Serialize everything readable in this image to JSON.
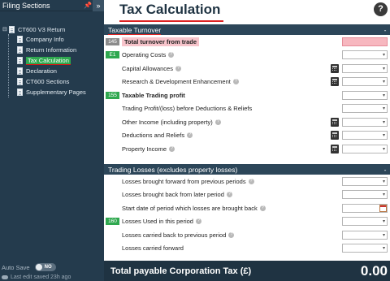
{
  "sidebar": {
    "title": "Filing Sections",
    "pin_icon": "pin-icon",
    "collapse_icon": "double-chevron-right-icon",
    "root": {
      "toggle": "⊟",
      "label": "CT600 V3 Return"
    },
    "items": [
      {
        "label": "Company Info",
        "active": false
      },
      {
        "label": "Return Information",
        "active": false
      },
      {
        "label": "Tax Calculation",
        "active": true
      },
      {
        "label": "Declaration",
        "active": false
      },
      {
        "label": "CT600 Sections",
        "active": false
      },
      {
        "label": "Supplementary Pages",
        "active": false
      }
    ],
    "autosave_label": "Auto Save",
    "autosave_toggle": "NO",
    "last_edit": "Last edit saved 23h ago"
  },
  "main": {
    "title": "Tax Calculation",
    "help_icon": "question-mark-icon",
    "section1": {
      "header": "Taxable Turnover",
      "rows": [
        {
          "box": "145",
          "label": "Total turnover from trade"
        },
        {
          "box": "E1",
          "label": "Operating Costs"
        },
        {
          "box": "",
          "label": "Capital Allowances"
        },
        {
          "box": "",
          "label": "Research & Development Enhancement"
        },
        {
          "box": "155",
          "label": "Taxable Trading profit"
        },
        {
          "box": "",
          "label": "Trading Profit/(loss) before Deductions & Reliefs"
        },
        {
          "box": "",
          "label": "Other Income (including property)"
        },
        {
          "box": "",
          "label": "Deductions and Reliefs"
        },
        {
          "box": "",
          "label": "Property Income"
        }
      ]
    },
    "section2": {
      "header": "Trading Losses (excludes property losses)",
      "rows": [
        {
          "box": "",
          "label": "Losses brought forward from previous periods"
        },
        {
          "box": "",
          "label": "Losses brought back from later period"
        },
        {
          "box": "",
          "label": "Start date of period which losses are brought back"
        },
        {
          "box": "160",
          "label": "Losses Used in this period"
        },
        {
          "box": "",
          "label": "Losses carried back to previous period"
        },
        {
          "box": "",
          "label": "Losses carried forward"
        }
      ]
    },
    "total": {
      "label": "Total payable Corporation Tax (£)",
      "value": "0.00"
    },
    "colors": {
      "sidebar_bg": "#243b4d",
      "header_bg": "#2c4659",
      "accent_green": "#2fa84f",
      "highlight_pink": "#f7b7bf",
      "title_underline": "#dd2222"
    }
  }
}
